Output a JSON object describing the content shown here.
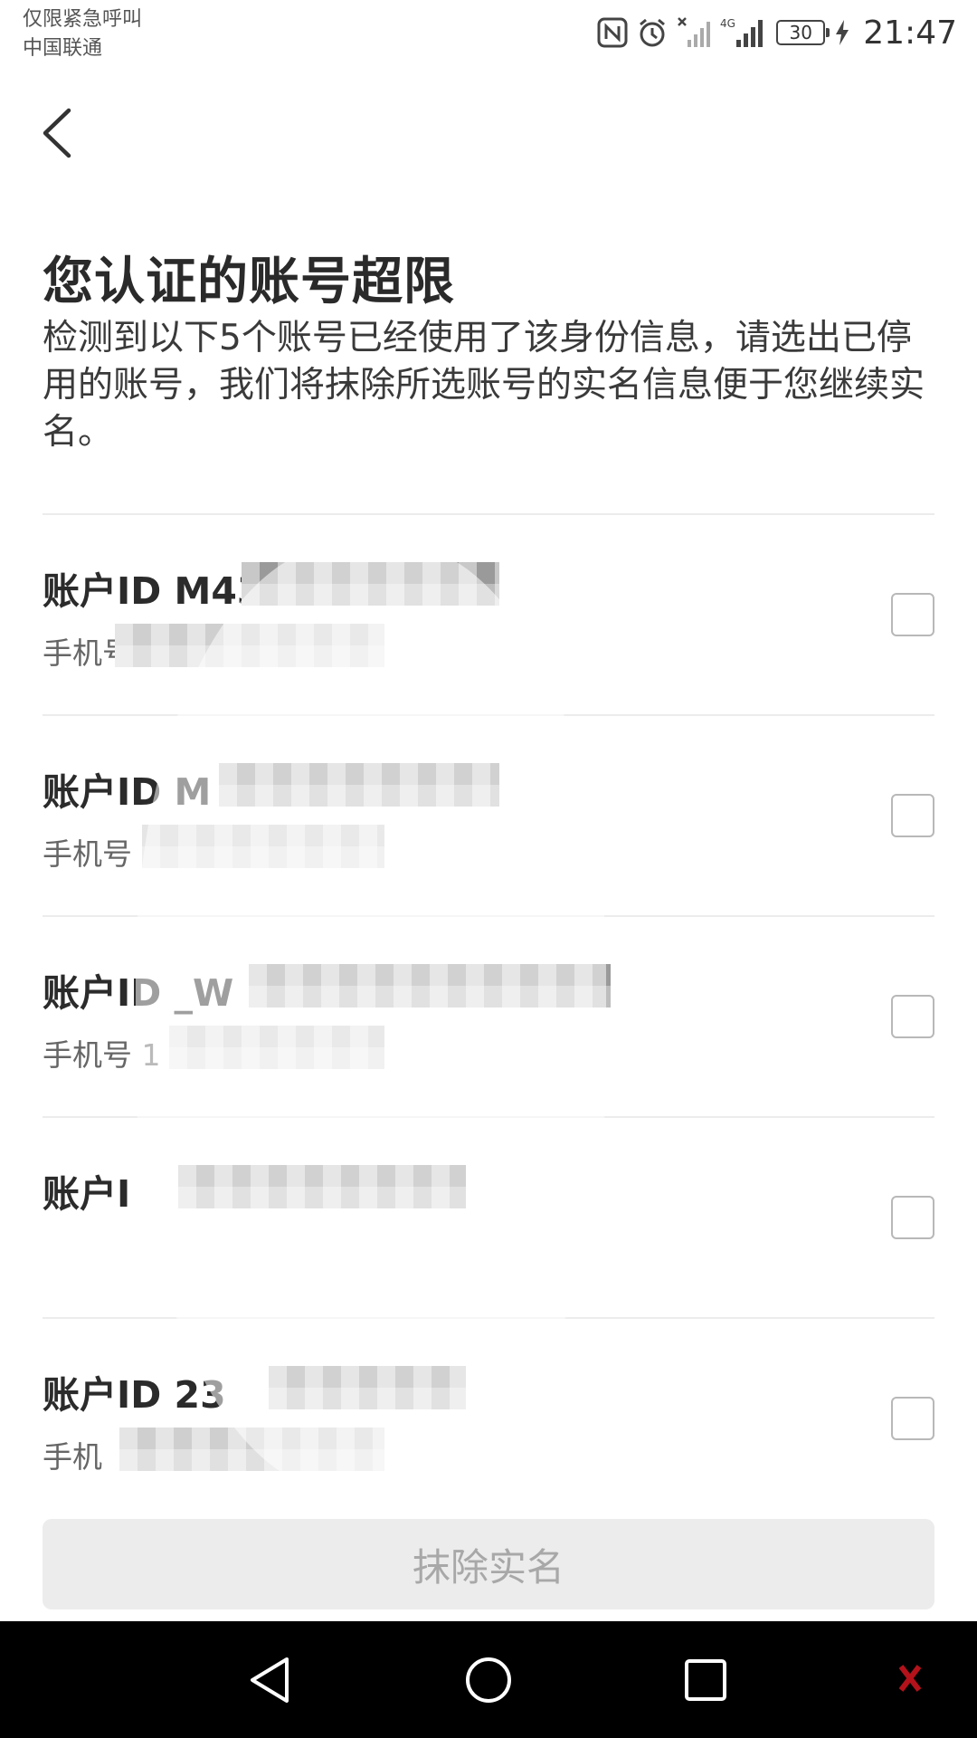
{
  "status_bar": {
    "carrier_line1": "仅限紧急呼叫",
    "carrier_line2": "中国联通",
    "network_label": "4G",
    "battery_level": "30",
    "time": "21:47"
  },
  "header": {
    "title": "您认证的账号超限",
    "description": "检测到以下5个账号已经使用了该身份信息，请选出已停用的账号，我们将抹除所选账号的实名信息便于您继续实名。"
  },
  "accounts": [
    {
      "id_label": "账户ID M43",
      "phone_label": "手机号 1",
      "checked": false
    },
    {
      "id_label": "账户ID M",
      "phone_label": "手机号",
      "checked": false
    },
    {
      "id_label": "账户ID _W",
      "phone_label": "手机号 1",
      "checked": false
    },
    {
      "id_label": "账户I",
      "phone_label": "",
      "checked": false
    },
    {
      "id_label": "账户ID 23",
      "phone_label": "手机",
      "checked": false
    }
  ],
  "action_button": {
    "label": "抹除实名",
    "enabled": false
  },
  "colors": {
    "title": "#2a2a2a",
    "disabled_button_bg": "#ececec",
    "disabled_button_text": "#a8a8a8",
    "nav_bar": "#000000"
  },
  "icons": [
    "nfc-icon",
    "alarm-icon",
    "no-signal-icon",
    "signal-icon",
    "battery-icon",
    "charging-icon",
    "back-arrow-icon",
    "nav-back-icon",
    "nav-home-icon",
    "nav-recents-icon"
  ]
}
